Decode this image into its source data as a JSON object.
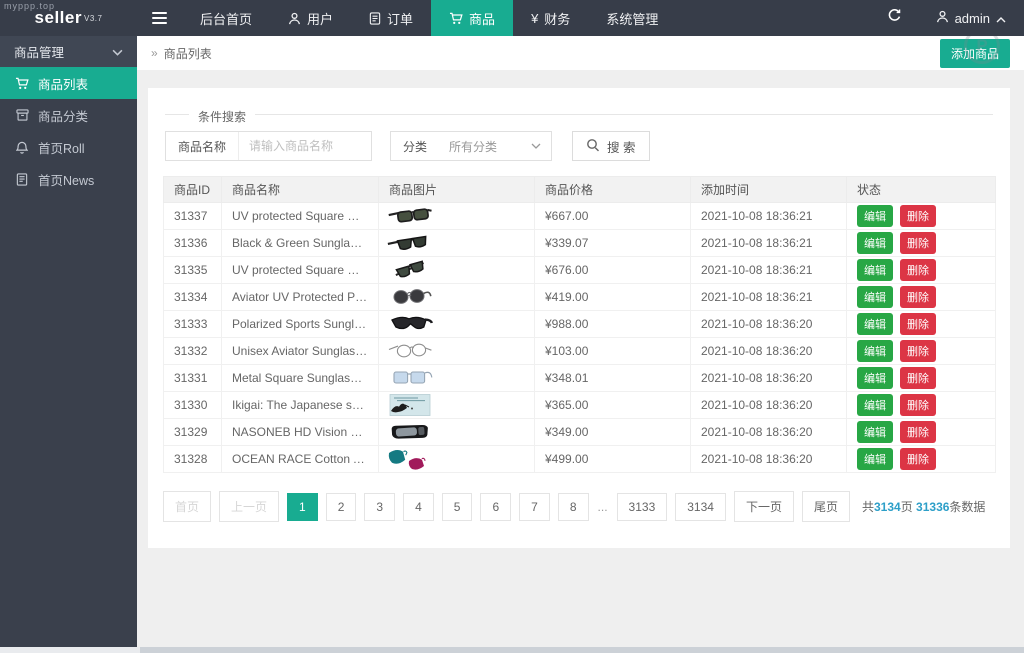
{
  "watermark": {
    "text": "myppp.top",
    "logo_letter": "P"
  },
  "colors": {
    "accent": "#18ac91",
    "green": "#28a745",
    "red": "#dc3545",
    "highlight": "#2d9fc8",
    "topbar": "#373d49",
    "sidebar": "#3a404c"
  },
  "topbar": {
    "logo_text": "seller",
    "logo_version": "V3.7",
    "nav": [
      {
        "label": "后台首页",
        "icon": null,
        "active": false
      },
      {
        "label": "用户",
        "icon": "user-icon",
        "active": false
      },
      {
        "label": "订单",
        "icon": "order-icon",
        "active": false
      },
      {
        "label": "商品",
        "icon": "cart-icon",
        "active": true
      },
      {
        "label": "财务",
        "icon": "yen-icon",
        "active": false
      },
      {
        "label": "系统管理",
        "icon": null,
        "active": false
      }
    ],
    "user": "admin"
  },
  "sidebar": {
    "group": "商品管理",
    "items": [
      {
        "label": "商品列表",
        "icon": "cart-icon",
        "active": true
      },
      {
        "label": "商品分类",
        "icon": "category-icon",
        "active": false
      },
      {
        "label": "首页Roll",
        "icon": "bell-icon",
        "active": false
      },
      {
        "label": "首页News",
        "icon": "news-icon",
        "active": false
      }
    ]
  },
  "breadcrumb": {
    "arrow": "»",
    "path": "商品列表",
    "add_button": "添加商品"
  },
  "search": {
    "legend": "条件搜索",
    "name_label": "商品名称",
    "name_placeholder": "请输入商品名称",
    "category_label": "分类",
    "category_value": "所有分类",
    "search_button": "搜 索"
  },
  "table": {
    "columns": [
      "商品ID",
      "商品名称",
      "商品图片",
      "商品价格",
      "添加时间",
      "状态"
    ],
    "edit_label": "编辑",
    "delete_label": "删除",
    "rows": [
      {
        "id": "31337",
        "name": "UV protected Square Men's Sun...",
        "image": "sunglasses-square-dark",
        "price": "¥667.00",
        "time": "2021-10-08 18:36:21"
      },
      {
        "id": "31336",
        "name": "Black & Green Sunglasses Comb...",
        "image": "sunglasses-wrap-dark",
        "price": "¥339.07",
        "time": "2021-10-08 18:36:21"
      },
      {
        "id": "31335",
        "name": "UV protected Square Men's Sun...",
        "image": "sunglasses-folded-dark",
        "price": "¥676.00",
        "time": "2021-10-08 18:36:21"
      },
      {
        "id": "31334",
        "name": "Aviator UV Protected Polarized ...",
        "image": "sunglasses-aviator-dark",
        "price": "¥419.00",
        "time": "2021-10-08 18:36:21"
      },
      {
        "id": "31333",
        "name": "Polarized Sports Sunglasses Mirr...",
        "image": "sunglasses-sport-dark",
        "price": "¥988.00",
        "time": "2021-10-08 18:36:20"
      },
      {
        "id": "31332",
        "name": "Unisex Aviator Sunglasses Comb...",
        "image": "sunglasses-aviator-wire",
        "price": "¥103.00",
        "time": "2021-10-08 18:36:20"
      },
      {
        "id": "31331",
        "name": "Metal Square Sunglasses for Me...",
        "image": "sunglasses-square-blue",
        "price": "¥348.01",
        "time": "2021-10-08 18:36:20"
      },
      {
        "id": "31330",
        "name": "Ikigai: The Japanese secret to a l...",
        "image": "book-cover-ikigai",
        "price": "¥365.00",
        "time": "2021-10-08 18:36:20"
      },
      {
        "id": "31329",
        "name": "NASONEB HD Vision Day and Ni...",
        "image": "sunglasses-fitover-dark",
        "price": "¥349.00",
        "time": "2021-10-08 18:36:20"
      },
      {
        "id": "31328",
        "name": "OCEAN RACE Cotton Anti Polluti...",
        "image": "face-masks-pair",
        "price": "¥499.00",
        "time": "2021-10-08 18:36:20"
      }
    ]
  },
  "pagination": {
    "first": {
      "label": "首页",
      "disabled": true
    },
    "prev": {
      "label": "上一页",
      "disabled": true
    },
    "pages": [
      "1",
      "2",
      "3",
      "4",
      "5",
      "6",
      "7",
      "8",
      "...",
      "3133",
      "3134"
    ],
    "active_page": "1",
    "next": {
      "label": "下一页",
      "disabled": false
    },
    "last": {
      "label": "尾页",
      "disabled": false
    },
    "summary": {
      "prefix": "共",
      "pages_count": "3134",
      "middle": "页 ",
      "records_count": "31336",
      "suffix": "条数据"
    }
  }
}
